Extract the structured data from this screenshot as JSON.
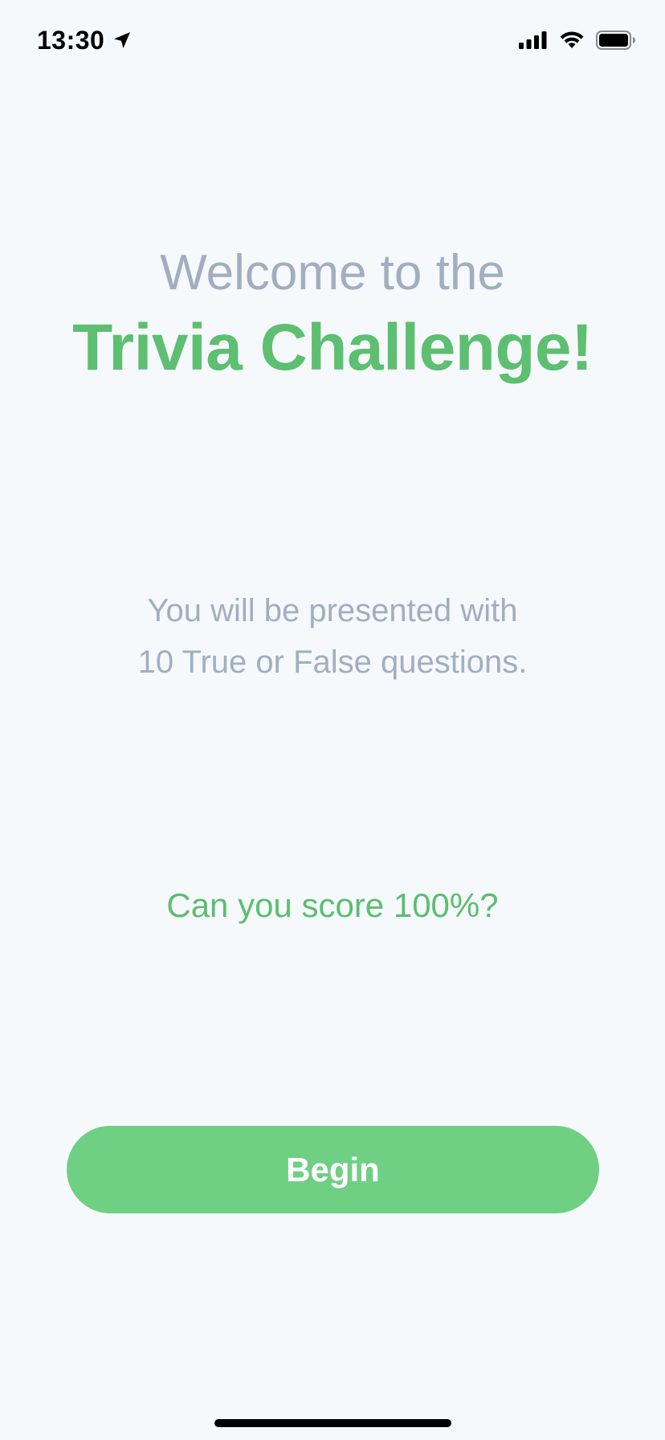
{
  "status_bar": {
    "time": "13:30",
    "location_icon": "location-arrow-icon",
    "signal_icon": "cellular-signal-icon",
    "wifi_icon": "wifi-icon",
    "battery_icon": "battery-icon"
  },
  "welcome": {
    "line1": "Welcome to the",
    "title": "Trivia Challenge!"
  },
  "description": {
    "line1": "You will be presented with",
    "line2": "10 True or False questions."
  },
  "challenge_text": "Can you score 100%?",
  "begin_button": {
    "label": "Begin"
  },
  "colors": {
    "background": "#f6f9fc",
    "accent_green": "#5dbf70",
    "button_green": "#6fd083",
    "muted_text": "#a2aec0"
  }
}
